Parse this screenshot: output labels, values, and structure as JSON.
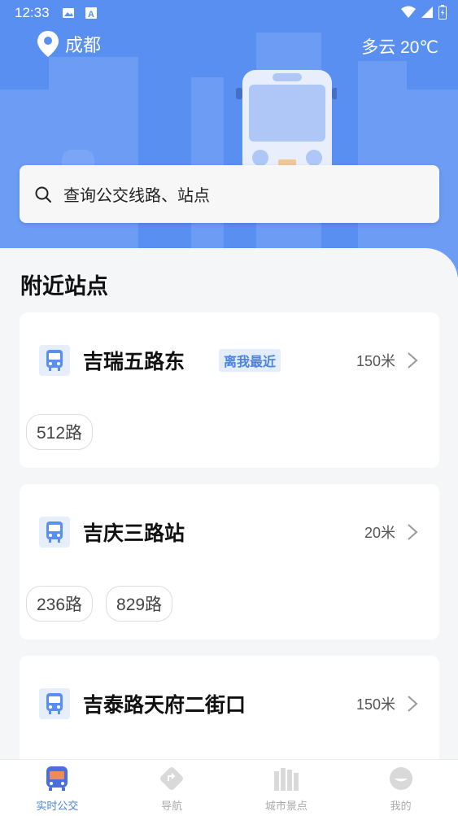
{
  "status_bar": {
    "time": "12:33"
  },
  "header": {
    "city": "成都",
    "weather": "多云 20℃"
  },
  "search": {
    "placeholder": "查询公交线路、站点"
  },
  "nearby": {
    "title": "附近站点",
    "stops": [
      {
        "name": "吉瑞五路东",
        "badge": "离我最近",
        "distance": "150米",
        "routes": [
          "512路"
        ]
      },
      {
        "name": "吉庆三路站",
        "distance": "20米",
        "routes": [
          "236路",
          "829路"
        ]
      },
      {
        "name": "吉泰路天府二街口",
        "distance": "150米",
        "routes": []
      }
    ]
  },
  "tabs": [
    {
      "label": "实时公交",
      "icon": "bus-icon",
      "active": true
    },
    {
      "label": "导航",
      "icon": "navigation-icon",
      "active": false
    },
    {
      "label": "城市景点",
      "icon": "city-icon",
      "active": false
    },
    {
      "label": "我的",
      "icon": "profile-icon",
      "active": false
    }
  ],
  "colors": {
    "accent": "#4a82e6",
    "header_bg": "#5a8ff2"
  }
}
